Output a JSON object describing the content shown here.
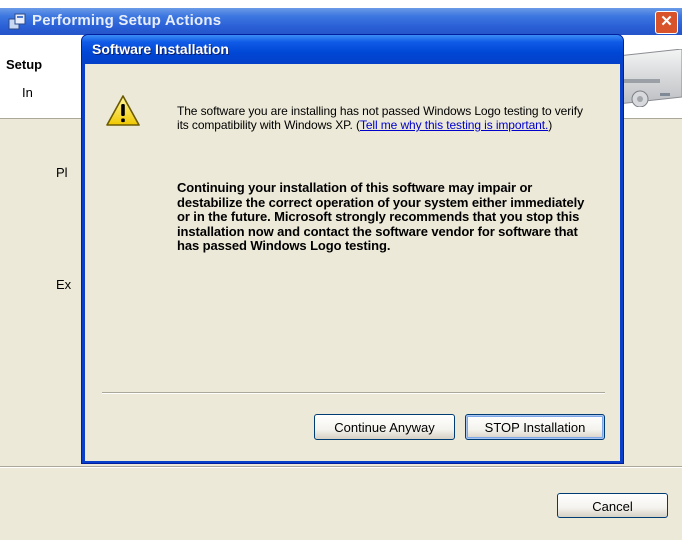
{
  "background_window": {
    "title": "Performing Setup Actions",
    "close_glyph": "✕",
    "header_heading": "Setup",
    "header_sub": "In",
    "body_line1": "Pl",
    "body_line2": "Ex",
    "cancel_label": "Cancel"
  },
  "dialog": {
    "title": "Software Installation",
    "icon": "warning-icon",
    "message1": "The software you are installing has not passed Windows Logo testing to verify its compatibility with Windows XP.",
    "message1_paren_open": " (",
    "link_text": "Tell me why this testing is important.",
    "message1_paren_close": ")",
    "message2": "Continuing your installation of this software may impair or destabilize the correct operation of your system either immediately or in the future. Microsoft strongly recommends that you stop this installation now and contact the software vendor for software that has passed Windows Logo testing.",
    "continue_label": "Continue Anyway",
    "stop_label": "STOP Installation"
  },
  "colors": {
    "title_blue": "#0047d6",
    "face": "#ece9d8",
    "link": "#0000cc",
    "close_red": "#d9532a"
  }
}
